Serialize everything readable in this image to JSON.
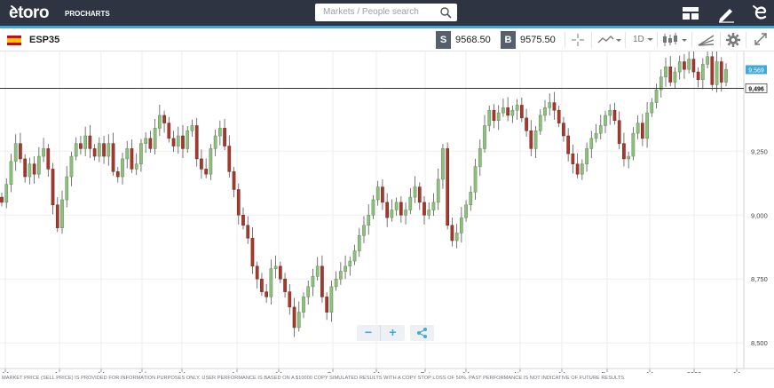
{
  "app": {
    "logo": "etoro",
    "logo_sub": "PROCHARTS"
  },
  "search": {
    "placeholder": "Markets / People search"
  },
  "topbar_icons": [
    "layout-icon",
    "edit-pencil-icon",
    "etoro-e-icon"
  ],
  "instrument": {
    "symbol": "ESP35",
    "sell_tag": "S",
    "sell_price": "9568.50",
    "buy_tag": "B",
    "buy_price": "9575.50",
    "interval": "1D"
  },
  "toolbar_icons": [
    "crosshair-icon",
    "indicators-icon",
    "interval-dropdown",
    "candles-icon",
    "drawing-tools-icon",
    "settings-gear-icon",
    "fullscreen-icon"
  ],
  "colors": {
    "topbar": "#2e3442",
    "accent": "#3fa9d7",
    "bull": "#8fbf7f",
    "bear": "#a33a2e",
    "wick": "#555555",
    "current_price_tag": "#3fa9d7"
  },
  "zoom_controls": {
    "minus": "−",
    "plus": "+"
  },
  "disclaimer": "MARKET PRICE (SELL PRICE) IS PROVIDED FOR INFORMATION PURPOSES ONLY. USER PERFORMANCE IS BASED ON A $10000 COPY SIMULATED RESULTS WITH A COPY STOP LOSS OF 50%. PAST PERFORMANCE IS NOT INDICATIVE OF FUTURE RESULTS.",
  "chart_data": {
    "type": "candlestick",
    "xlabels": [
      "14",
      "Jun",
      "14",
      "Jul",
      "14",
      "Aug",
      "14",
      "Sep",
      "14",
      "Oct",
      "14",
      "Nov",
      "14",
      "Dec",
      "14",
      "2020",
      "14"
    ],
    "y_ticks": [
      "8,500",
      "8,750",
      "9,000",
      "9,250"
    ],
    "ylim": [
      8400,
      9640
    ],
    "current_price_label": "9,569",
    "current_price": 9569,
    "hline_label": "9,496",
    "hline_value": 9496,
    "grid": true,
    "closes": [
      9050,
      9120,
      9210,
      9280,
      9220,
      9150,
      9200,
      9160,
      9230,
      9260,
      9180,
      9040,
      8950,
      9060,
      9150,
      9230,
      9280,
      9260,
      9310,
      9260,
      9230,
      9280,
      9230,
      9280,
      9170,
      9150,
      9220,
      9260,
      9180,
      9200,
      9280,
      9300,
      9260,
      9340,
      9390,
      9360,
      9300,
      9270,
      9310,
      9260,
      9330,
      9350,
      9220,
      9180,
      9160,
      9260,
      9310,
      9340,
      9270,
      9170,
      9100,
      9000,
      8960,
      8910,
      8800,
      8750,
      8700,
      8680,
      8790,
      8800,
      8750,
      8700,
      8640,
      8560,
      8620,
      8680,
      8720,
      8760,
      8800,
      8680,
      8620,
      8720,
      8750,
      8780,
      8800,
      8820,
      8860,
      8920,
      8960,
      9000,
      9060,
      9110,
      9050,
      8990,
      9020,
      9050,
      9000,
      9020,
      9070,
      9110,
      9050,
      9000,
      9020,
      9050,
      9140,
      9260,
      8960,
      8900,
      8930,
      8990,
      9040,
      9090,
      9190,
      9260,
      9350,
      9410,
      9370,
      9400,
      9420,
      9390,
      9410,
      9430,
      9380,
      9330,
      9260,
      9330,
      9390,
      9420,
      9440,
      9410,
      9360,
      9310,
      9240,
      9200,
      9160,
      9200,
      9260,
      9300,
      9320,
      9350,
      9390,
      9410,
      9370,
      9280,
      9220,
      9230,
      9320,
      9360,
      9300,
      9400,
      9440,
      9490,
      9540,
      9580,
      9520,
      9560,
      9600,
      9570,
      9610,
      9560,
      9530,
      9590,
      9620,
      9510,
      9600,
      9520,
      9570
    ]
  }
}
